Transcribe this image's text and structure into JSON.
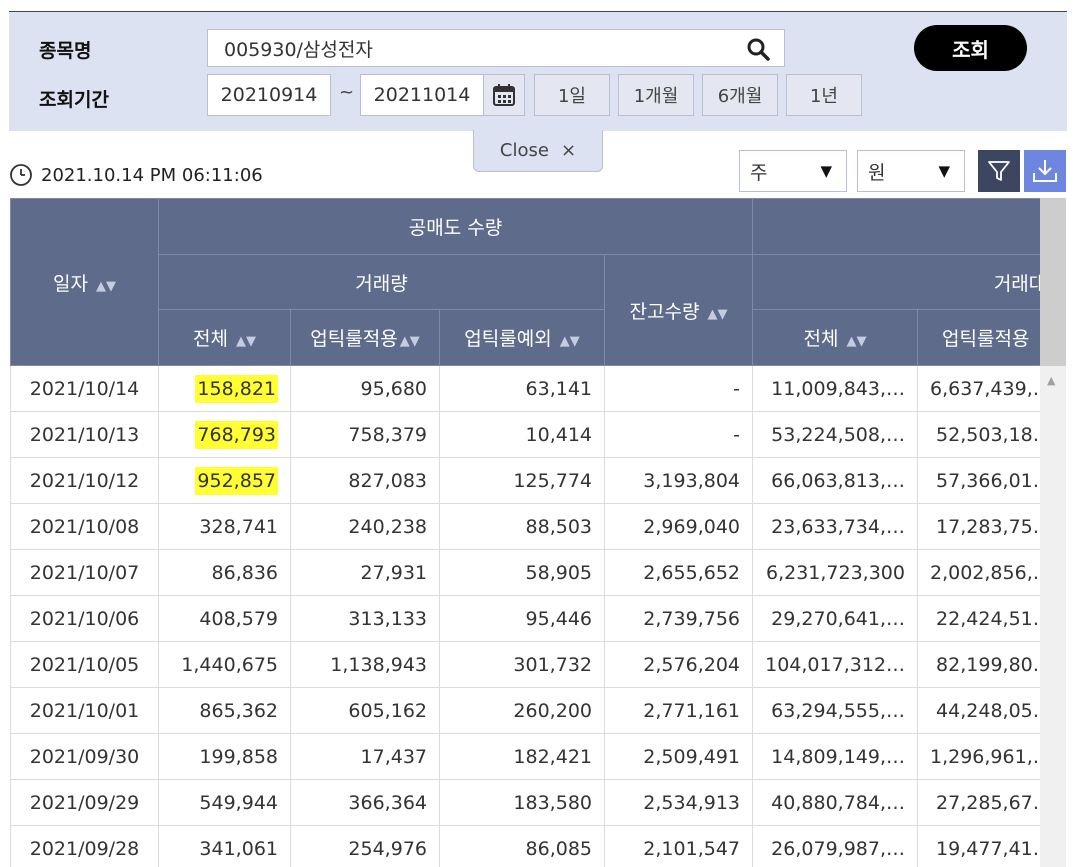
{
  "search": {
    "stock_label": "종목명",
    "stock_value": "005930/삼성전자",
    "period_label": "조회기간",
    "date_from": "20210914",
    "date_sep": "~",
    "date_to": "20211014",
    "periods": [
      "1일",
      "1개월",
      "6개월",
      "1년"
    ],
    "query_label": "조회",
    "close_label": "Close",
    "close_symbol": "×"
  },
  "toolbar": {
    "timestamp": "2021.10.14 PM 06:11:06",
    "unit_select": "주",
    "currency_select": "원"
  },
  "table": {
    "headers": {
      "date": "일자",
      "short_volume_group": "공매도 수량",
      "trade_volume": "거래량",
      "total": "전체",
      "uptick_applied": "업틱룰적용",
      "uptick_exempt": "업틱룰예외",
      "balance_volume": "잔고수량",
      "trade_amount": "거래대금",
      "amount_total": "전체",
      "amount_uptick_applied": "업틱룰적용"
    },
    "rows": [
      [
        "2021/10/14",
        "158,821",
        "95,680",
        "63,141",
        "-",
        "11,009,843,…",
        "6,637,439,…"
      ],
      [
        "2021/10/13",
        "768,793",
        "758,379",
        "10,414",
        "-",
        "53,224,508,…",
        "52,503,18…"
      ],
      [
        "2021/10/12",
        "952,857",
        "827,083",
        "125,774",
        "3,193,804",
        "66,063,813,…",
        "57,366,01…"
      ],
      [
        "2021/10/08",
        "328,741",
        "240,238",
        "88,503",
        "2,969,040",
        "23,633,734,…",
        "17,283,75…"
      ],
      [
        "2021/10/07",
        "86,836",
        "27,931",
        "58,905",
        "2,655,652",
        "6,231,723,300",
        "2,002,856,…"
      ],
      [
        "2021/10/06",
        "408,579",
        "313,133",
        "95,446",
        "2,739,756",
        "29,270,641,…",
        "22,424,51…"
      ],
      [
        "2021/10/05",
        "1,440,675",
        "1,138,943",
        "301,732",
        "2,576,204",
        "104,017,312…",
        "82,199,80…"
      ],
      [
        "2021/10/01",
        "865,362",
        "605,162",
        "260,200",
        "2,771,161",
        "63,294,555,…",
        "44,248,05…"
      ],
      [
        "2021/09/30",
        "199,858",
        "17,437",
        "182,421",
        "2,509,491",
        "14,809,149,…",
        "1,296,961,…"
      ],
      [
        "2021/09/29",
        "549,944",
        "366,364",
        "183,580",
        "2,534,913",
        "40,880,784,…",
        "27,285,67…"
      ],
      [
        "2021/09/28",
        "341,061",
        "254,976",
        "86,085",
        "2,101,547",
        "26,079,987,…",
        "19,477,41…"
      ]
    ],
    "highlighted_rows": [
      0,
      1,
      2
    ],
    "highlight_color": "#ffff33"
  },
  "colors": {
    "header_bg": "#5e6b8b",
    "panel_bg": "#dde2f2",
    "download_bg": "#6f86e0",
    "filter_bg": "#3c4661"
  }
}
